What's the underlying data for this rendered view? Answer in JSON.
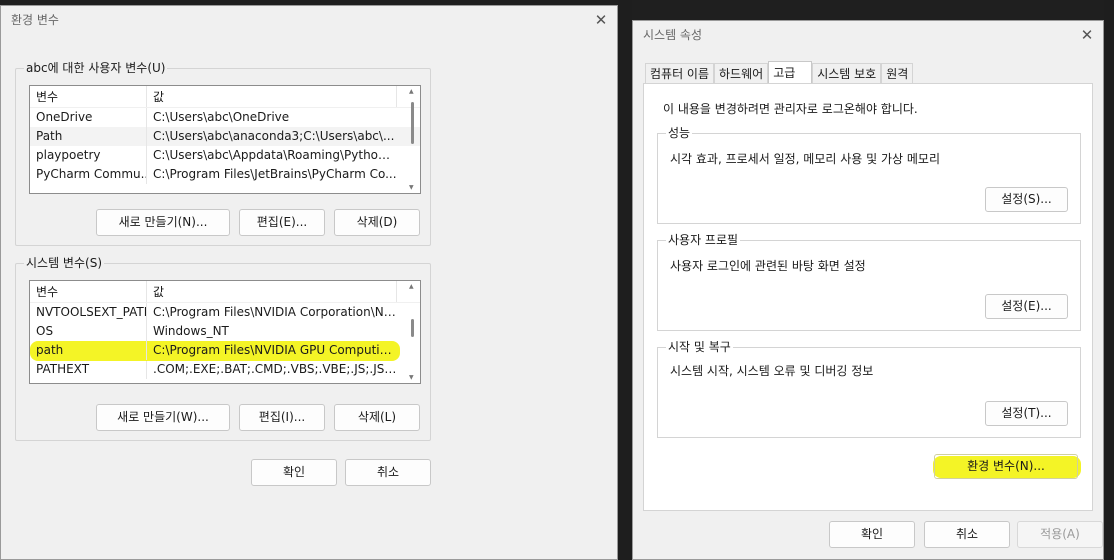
{
  "env_dialog": {
    "title": "환경 변수",
    "user_group_label": "abc에 대한 사용자 변수(U)",
    "columns": [
      "변수",
      "값"
    ],
    "user_vars": [
      {
        "name": "OneDrive",
        "value": "C:\\Users\\abc\\OneDrive"
      },
      {
        "name": "Path",
        "value": "C:\\Users\\abc\\anaconda3;C:\\Users\\abc\\..."
      },
      {
        "name": "playpoetry",
        "value": "C:\\Users\\abc\\Appdata\\Roaming\\Python..."
      },
      {
        "name": "PyCharm Commu...",
        "value": "C:\\Program Files\\JetBrains\\PyCharm Co..."
      }
    ],
    "user_buttons": {
      "new": "새로 만들기(N)...",
      "edit": "편집(E)...",
      "delete": "삭제(D)"
    },
    "system_group_label": "시스템 변수(S)",
    "system_vars": [
      {
        "name": "NVTOOLSEXT_PATH",
        "value": "C:\\Program Files\\NVIDIA Corporation\\Nv..."
      },
      {
        "name": "OS",
        "value": "Windows_NT"
      },
      {
        "name": "path",
        "value": "C:\\Program Files\\NVIDIA GPU Computing..."
      },
      {
        "name": "PATHEXT",
        "value": ".COM;.EXE;.BAT;.CMD;.VBS;.VBE;.JS;.JSE;.W..."
      }
    ],
    "system_buttons": {
      "new": "새로 만들기(W)...",
      "edit": "편집(I)...",
      "delete": "삭제(L)"
    },
    "ok": "확인",
    "cancel": "취소"
  },
  "sys_dialog": {
    "title": "시스템 속성",
    "tabs": [
      "컴퓨터 이름",
      "하드웨어",
      "고급",
      "시스템 보호",
      "원격"
    ],
    "active_tab": "고급",
    "admin_note": "이 내용을 변경하려면 관리자로 로그온해야 합니다.",
    "performance": {
      "label": "성능",
      "desc": "시각 효과, 프로세서 일정, 메모리 사용 및 가상 메모리",
      "button": "설정(S)..."
    },
    "user_profile": {
      "label": "사용자 프로필",
      "desc": "사용자 로그인에 관련된 바탕 화면 설정",
      "button": "설정(E)..."
    },
    "startup": {
      "label": "시작 및 복구",
      "desc": "시스템 시작, 시스템 오류 및 디버깅 정보",
      "button": "설정(T)..."
    },
    "env_button": "환경 변수(N)...",
    "ok": "확인",
    "cancel": "취소",
    "apply": "적용(A)"
  },
  "colors": {
    "highlight": "#f2f200",
    "dialog_bg": "#f0f0f0",
    "desktop_bg": "#1f1f1f"
  }
}
